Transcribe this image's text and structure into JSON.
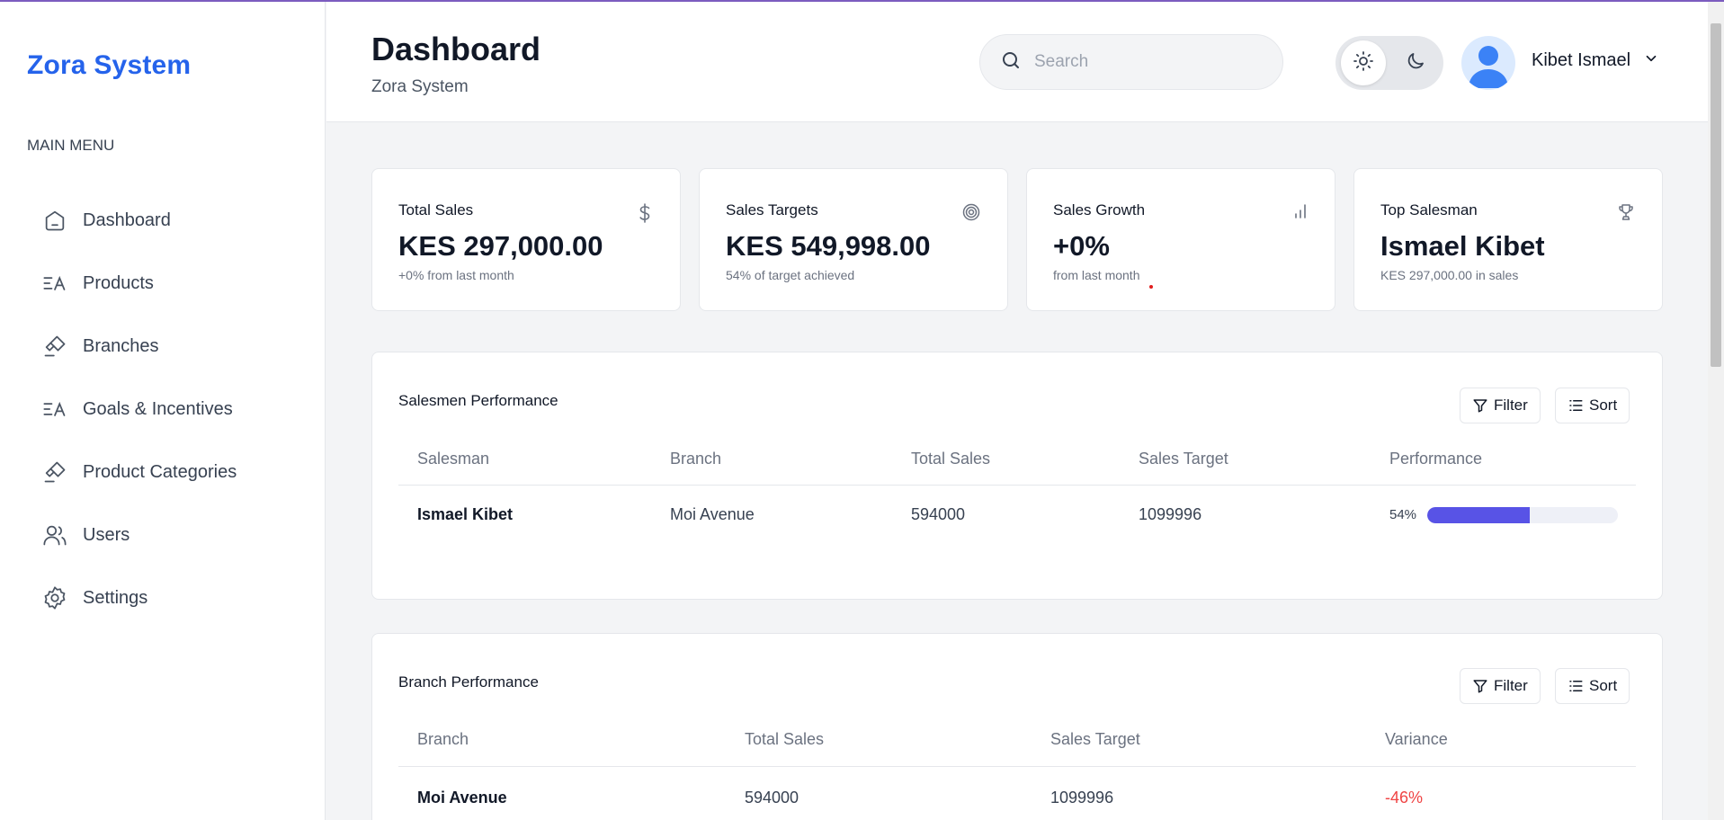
{
  "sidebar": {
    "brand": "Zora System",
    "menu_title": "MAIN MENU",
    "items": [
      {
        "label": "Dashboard",
        "icon": "home-icon"
      },
      {
        "label": "Products",
        "icon": "list-text-icon"
      },
      {
        "label": "Branches",
        "icon": "brush-icon"
      },
      {
        "label": "Goals & Incentives",
        "icon": "list-text-icon"
      },
      {
        "label": "Product Categories",
        "icon": "brush-icon"
      },
      {
        "label": "Users",
        "icon": "users-icon"
      },
      {
        "label": "Settings",
        "icon": "gear-icon"
      }
    ]
  },
  "header": {
    "title": "Dashboard",
    "subtitle": "Zora System",
    "search_placeholder": "Search",
    "user_name": "Kibet Ismael"
  },
  "stats": [
    {
      "title": "Total Sales",
      "value": "KES 297,000.00",
      "note": "+0% from last month",
      "icon": "dollar-icon"
    },
    {
      "title": "Sales Targets",
      "value": "KES 549,998.00",
      "note": "54% of target achieved",
      "icon": "target-icon"
    },
    {
      "title": "Sales Growth",
      "value": "+0%",
      "note": "from last month",
      "icon": "bar-chart-icon"
    },
    {
      "title": "Top Salesman",
      "value": "Ismael Kibet",
      "note": "KES 297,000.00 in sales",
      "icon": "trophy-icon"
    }
  ],
  "salesmen": {
    "title": "Salesmen Performance",
    "filter_label": "Filter",
    "sort_label": "Sort",
    "columns": [
      "Salesman",
      "Branch",
      "Total Sales",
      "Sales Target",
      "Performance"
    ],
    "rows": [
      {
        "salesman": "Ismael Kibet",
        "branch": "Moi Avenue",
        "total_sales": "594000",
        "sales_target": "1099996",
        "performance_label": "54%",
        "performance": 0.54
      }
    ]
  },
  "branches": {
    "title": "Branch Performance",
    "filter_label": "Filter",
    "sort_label": "Sort",
    "columns": [
      "Branch",
      "Total Sales",
      "Sales Target",
      "Variance"
    ],
    "rows": [
      {
        "branch": "Moi Avenue",
        "total_sales": "594000",
        "sales_target": "1099996",
        "variance": "-46%"
      }
    ]
  },
  "colors": {
    "brand": "#2563eb",
    "progress": "#5853e6",
    "negative": "#ef4444"
  }
}
